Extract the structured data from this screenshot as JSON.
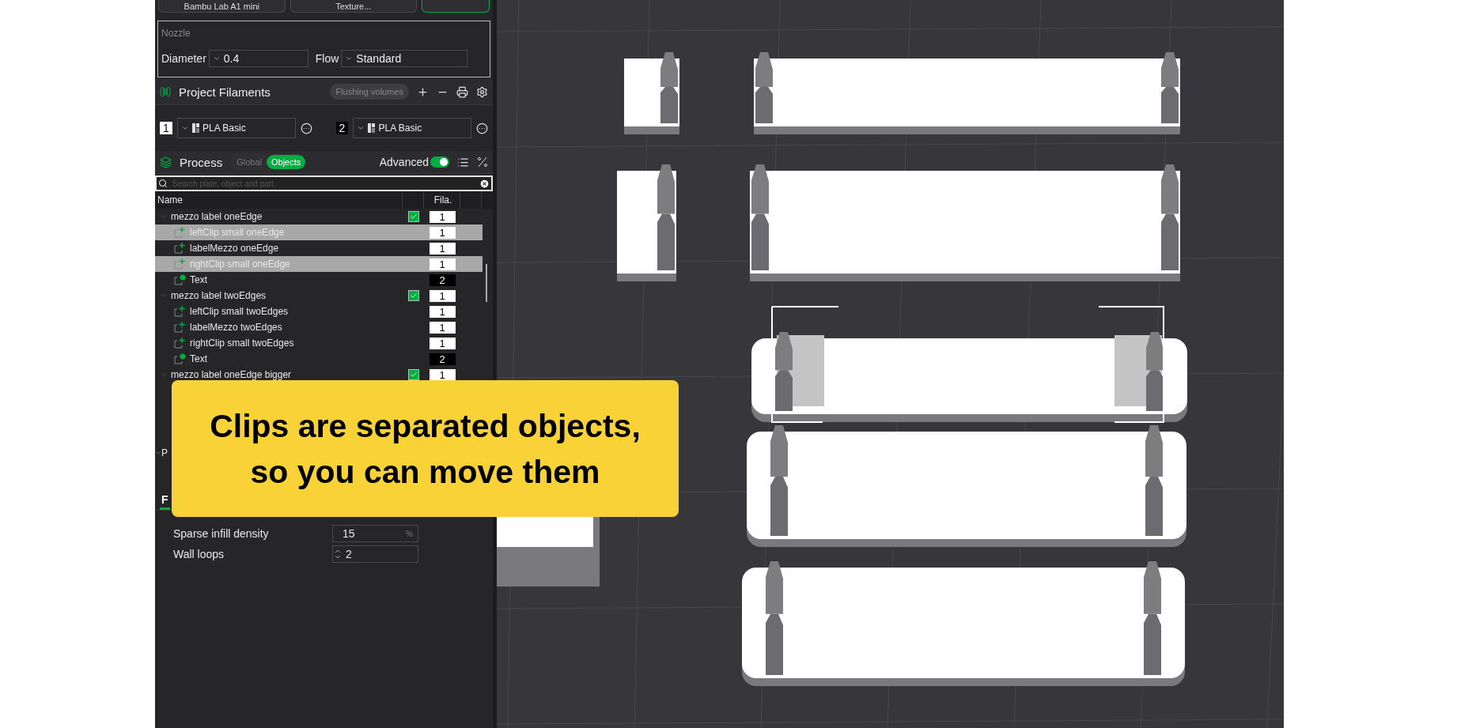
{
  "printer_bar": {
    "buttons": [
      {
        "label": "Bambu Lab A1 mini",
        "selected": false
      },
      {
        "label": "Texture...",
        "selected": false
      },
      {
        "selected": true
      }
    ]
  },
  "nozzle": {
    "title": "Nozzle",
    "diameter_label": "Diameter",
    "diameter": "0.4",
    "flow_label": "Flow",
    "flow": "Standard"
  },
  "project_filaments": {
    "title": "Project Filaments",
    "flushing_button": "Flushing volumes",
    "filaments": [
      {
        "index": "1",
        "name": "PLA Basic",
        "color": "#ffffff"
      },
      {
        "index": "2",
        "name": "PLA Basic",
        "color": "#000000"
      }
    ]
  },
  "process": {
    "title": "Process",
    "scopes": [
      {
        "label": "Global",
        "selected": false
      },
      {
        "label": "Objects",
        "selected": true
      }
    ],
    "advanced_label": "Advanced",
    "advanced_on": true,
    "search_placeholder": "Search plate, object and part."
  },
  "object_list": {
    "columns": [
      "Name",
      "Fila."
    ],
    "rows": [
      {
        "name": "mezzo label oneEdge",
        "filament": "1",
        "color": "#ffffff",
        "checked": true,
        "children": [
          {
            "name": "leftClip small oneEdge",
            "filament": "1",
            "color": "#ffffff",
            "kind": "part",
            "selected": true
          },
          {
            "name": "labelMezzo oneEdge",
            "filament": "1",
            "color": "#ffffff",
            "kind": "part",
            "selected": false
          },
          {
            "name": "rightClip small oneEdge",
            "filament": "1",
            "color": "#ffffff",
            "kind": "part",
            "selected": true
          },
          {
            "name": "Text",
            "filament": "2",
            "color": "#000000",
            "kind": "text",
            "selected": false
          }
        ]
      },
      {
        "name": "mezzo label twoEdges",
        "filament": "1",
        "color": "#ffffff",
        "checked": true,
        "children": [
          {
            "name": "leftClip small twoEdges",
            "filament": "1",
            "color": "#ffffff",
            "kind": "part",
            "selected": false
          },
          {
            "name": "labelMezzo twoEdges",
            "filament": "1",
            "color": "#ffffff",
            "kind": "part",
            "selected": false
          },
          {
            "name": "rightClip small twoEdges",
            "filament": "1",
            "color": "#ffffff",
            "kind": "part",
            "selected": false
          },
          {
            "name": "Text",
            "filament": "2",
            "color": "#000000",
            "kind": "text",
            "selected": false
          }
        ]
      },
      {
        "name": "mezzo label oneEdge bigger",
        "filament": "1",
        "color": "#ffffff",
        "checked": true,
        "children": []
      }
    ]
  },
  "collapsed_section": {
    "label": "P"
  },
  "settings_tabs": [
    {
      "label": "F",
      "selected": true
    }
  ],
  "settings": [
    {
      "label": "Sparse infill density",
      "value": "15",
      "unit": "%",
      "kind": "unit"
    },
    {
      "label": "Wall loops",
      "value": "2",
      "kind": "spin"
    }
  ],
  "caption": {
    "lines": [
      "Clips are separated objects,",
      "so you can move them"
    ]
  }
}
